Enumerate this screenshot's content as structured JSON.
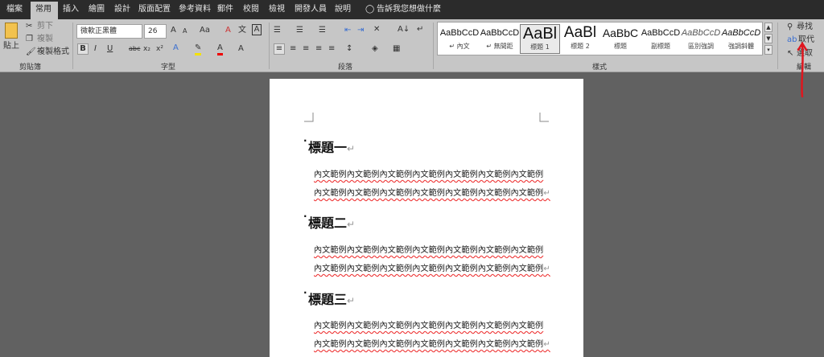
{
  "tabs": [
    "檔案",
    "常用",
    "插入",
    "繪圖",
    "設計",
    "版面配置",
    "參考資料",
    "郵件",
    "校閱",
    "檢視",
    "開發人員",
    "說明"
  ],
  "tell_me": "告訴我您想做什麼",
  "clipboard": {
    "paste": "貼上",
    "cut": "剪下",
    "copy": "複製",
    "format_painter": "複製格式",
    "label": "剪貼簿"
  },
  "font": {
    "name": "微軟正黑體",
    "size": "26",
    "grow": "A",
    "shrink": "A",
    "case": "Aa",
    "label": "字型"
  },
  "paragraph": {
    "label": "段落"
  },
  "styles": {
    "label": "樣式",
    "items": [
      {
        "preview": "AaBbCcD",
        "name": "↵ 內文"
      },
      {
        "preview": "AaBbCcD",
        "name": "↵ 無間距"
      },
      {
        "preview": "AaBl",
        "name": "標題 1"
      },
      {
        "preview": "AaBl",
        "name": "標題 2"
      },
      {
        "preview": "AaBbC",
        "name": "標題"
      },
      {
        "preview": "AaBbCcD",
        "name": "副標題"
      },
      {
        "preview": "AaBbCcD",
        "name": "區別強調"
      },
      {
        "preview": "AaBbCcD",
        "name": "強調斜體"
      }
    ]
  },
  "editing": {
    "find": "尋找",
    "replace": "取代",
    "select": "選取",
    "label": "編輯"
  },
  "document": {
    "headings": [
      "標題一",
      "標題二",
      "標題三"
    ],
    "body_line": "內文範例內文範例內文範例內文範例內文範例內文範例內文範例",
    "para_mark": "↵",
    "bullet": "·"
  },
  "colors": {
    "ribbon": "#c6c6c6",
    "tabbar": "#2b2b2b",
    "canvas": "#616161",
    "annotation": "#e0161e"
  }
}
